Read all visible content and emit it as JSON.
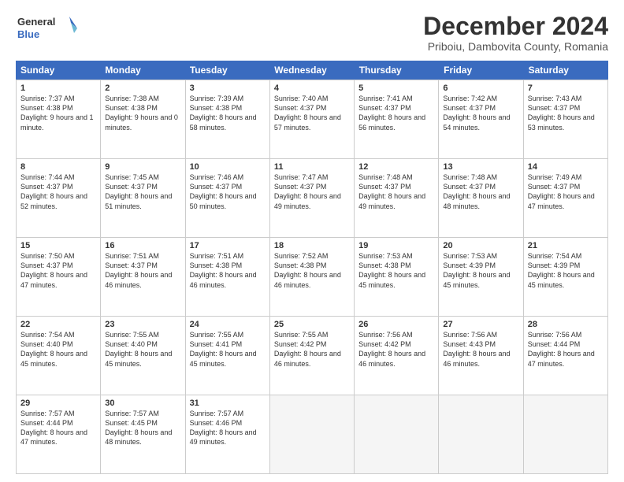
{
  "header": {
    "logo_line1": "General",
    "logo_line2": "Blue",
    "title": "December 2024",
    "subtitle": "Priboiu, Dambovita County, Romania"
  },
  "calendar": {
    "days": [
      "Sunday",
      "Monday",
      "Tuesday",
      "Wednesday",
      "Thursday",
      "Friday",
      "Saturday"
    ],
    "rows": [
      [
        {
          "day": "1",
          "sunrise": "Sunrise: 7:37 AM",
          "sunset": "Sunset: 4:38 PM",
          "daylight": "Daylight: 9 hours and 1 minute."
        },
        {
          "day": "2",
          "sunrise": "Sunrise: 7:38 AM",
          "sunset": "Sunset: 4:38 PM",
          "daylight": "Daylight: 9 hours and 0 minutes."
        },
        {
          "day": "3",
          "sunrise": "Sunrise: 7:39 AM",
          "sunset": "Sunset: 4:38 PM",
          "daylight": "Daylight: 8 hours and 58 minutes."
        },
        {
          "day": "4",
          "sunrise": "Sunrise: 7:40 AM",
          "sunset": "Sunset: 4:37 PM",
          "daylight": "Daylight: 8 hours and 57 minutes."
        },
        {
          "day": "5",
          "sunrise": "Sunrise: 7:41 AM",
          "sunset": "Sunset: 4:37 PM",
          "daylight": "Daylight: 8 hours and 56 minutes."
        },
        {
          "day": "6",
          "sunrise": "Sunrise: 7:42 AM",
          "sunset": "Sunset: 4:37 PM",
          "daylight": "Daylight: 8 hours and 54 minutes."
        },
        {
          "day": "7",
          "sunrise": "Sunrise: 7:43 AM",
          "sunset": "Sunset: 4:37 PM",
          "daylight": "Daylight: 8 hours and 53 minutes."
        }
      ],
      [
        {
          "day": "8",
          "sunrise": "Sunrise: 7:44 AM",
          "sunset": "Sunset: 4:37 PM",
          "daylight": "Daylight: 8 hours and 52 minutes."
        },
        {
          "day": "9",
          "sunrise": "Sunrise: 7:45 AM",
          "sunset": "Sunset: 4:37 PM",
          "daylight": "Daylight: 8 hours and 51 minutes."
        },
        {
          "day": "10",
          "sunrise": "Sunrise: 7:46 AM",
          "sunset": "Sunset: 4:37 PM",
          "daylight": "Daylight: 8 hours and 50 minutes."
        },
        {
          "day": "11",
          "sunrise": "Sunrise: 7:47 AM",
          "sunset": "Sunset: 4:37 PM",
          "daylight": "Daylight: 8 hours and 49 minutes."
        },
        {
          "day": "12",
          "sunrise": "Sunrise: 7:48 AM",
          "sunset": "Sunset: 4:37 PM",
          "daylight": "Daylight: 8 hours and 49 minutes."
        },
        {
          "day": "13",
          "sunrise": "Sunrise: 7:48 AM",
          "sunset": "Sunset: 4:37 PM",
          "daylight": "Daylight: 8 hours and 48 minutes."
        },
        {
          "day": "14",
          "sunrise": "Sunrise: 7:49 AM",
          "sunset": "Sunset: 4:37 PM",
          "daylight": "Daylight: 8 hours and 47 minutes."
        }
      ],
      [
        {
          "day": "15",
          "sunrise": "Sunrise: 7:50 AM",
          "sunset": "Sunset: 4:37 PM",
          "daylight": "Daylight: 8 hours and 47 minutes."
        },
        {
          "day": "16",
          "sunrise": "Sunrise: 7:51 AM",
          "sunset": "Sunset: 4:37 PM",
          "daylight": "Daylight: 8 hours and 46 minutes."
        },
        {
          "day": "17",
          "sunrise": "Sunrise: 7:51 AM",
          "sunset": "Sunset: 4:38 PM",
          "daylight": "Daylight: 8 hours and 46 minutes."
        },
        {
          "day": "18",
          "sunrise": "Sunrise: 7:52 AM",
          "sunset": "Sunset: 4:38 PM",
          "daylight": "Daylight: 8 hours and 46 minutes."
        },
        {
          "day": "19",
          "sunrise": "Sunrise: 7:53 AM",
          "sunset": "Sunset: 4:38 PM",
          "daylight": "Daylight: 8 hours and 45 minutes."
        },
        {
          "day": "20",
          "sunrise": "Sunrise: 7:53 AM",
          "sunset": "Sunset: 4:39 PM",
          "daylight": "Daylight: 8 hours and 45 minutes."
        },
        {
          "day": "21",
          "sunrise": "Sunrise: 7:54 AM",
          "sunset": "Sunset: 4:39 PM",
          "daylight": "Daylight: 8 hours and 45 minutes."
        }
      ],
      [
        {
          "day": "22",
          "sunrise": "Sunrise: 7:54 AM",
          "sunset": "Sunset: 4:40 PM",
          "daylight": "Daylight: 8 hours and 45 minutes."
        },
        {
          "day": "23",
          "sunrise": "Sunrise: 7:55 AM",
          "sunset": "Sunset: 4:40 PM",
          "daylight": "Daylight: 8 hours and 45 minutes."
        },
        {
          "day": "24",
          "sunrise": "Sunrise: 7:55 AM",
          "sunset": "Sunset: 4:41 PM",
          "daylight": "Daylight: 8 hours and 45 minutes."
        },
        {
          "day": "25",
          "sunrise": "Sunrise: 7:55 AM",
          "sunset": "Sunset: 4:42 PM",
          "daylight": "Daylight: 8 hours and 46 minutes."
        },
        {
          "day": "26",
          "sunrise": "Sunrise: 7:56 AM",
          "sunset": "Sunset: 4:42 PM",
          "daylight": "Daylight: 8 hours and 46 minutes."
        },
        {
          "day": "27",
          "sunrise": "Sunrise: 7:56 AM",
          "sunset": "Sunset: 4:43 PM",
          "daylight": "Daylight: 8 hours and 46 minutes."
        },
        {
          "day": "28",
          "sunrise": "Sunrise: 7:56 AM",
          "sunset": "Sunset: 4:44 PM",
          "daylight": "Daylight: 8 hours and 47 minutes."
        }
      ],
      [
        {
          "day": "29",
          "sunrise": "Sunrise: 7:57 AM",
          "sunset": "Sunset: 4:44 PM",
          "daylight": "Daylight: 8 hours and 47 minutes."
        },
        {
          "day": "30",
          "sunrise": "Sunrise: 7:57 AM",
          "sunset": "Sunset: 4:45 PM",
          "daylight": "Daylight: 8 hours and 48 minutes."
        },
        {
          "day": "31",
          "sunrise": "Sunrise: 7:57 AM",
          "sunset": "Sunset: 4:46 PM",
          "daylight": "Daylight: 8 hours and 49 minutes."
        },
        null,
        null,
        null,
        null
      ]
    ]
  }
}
